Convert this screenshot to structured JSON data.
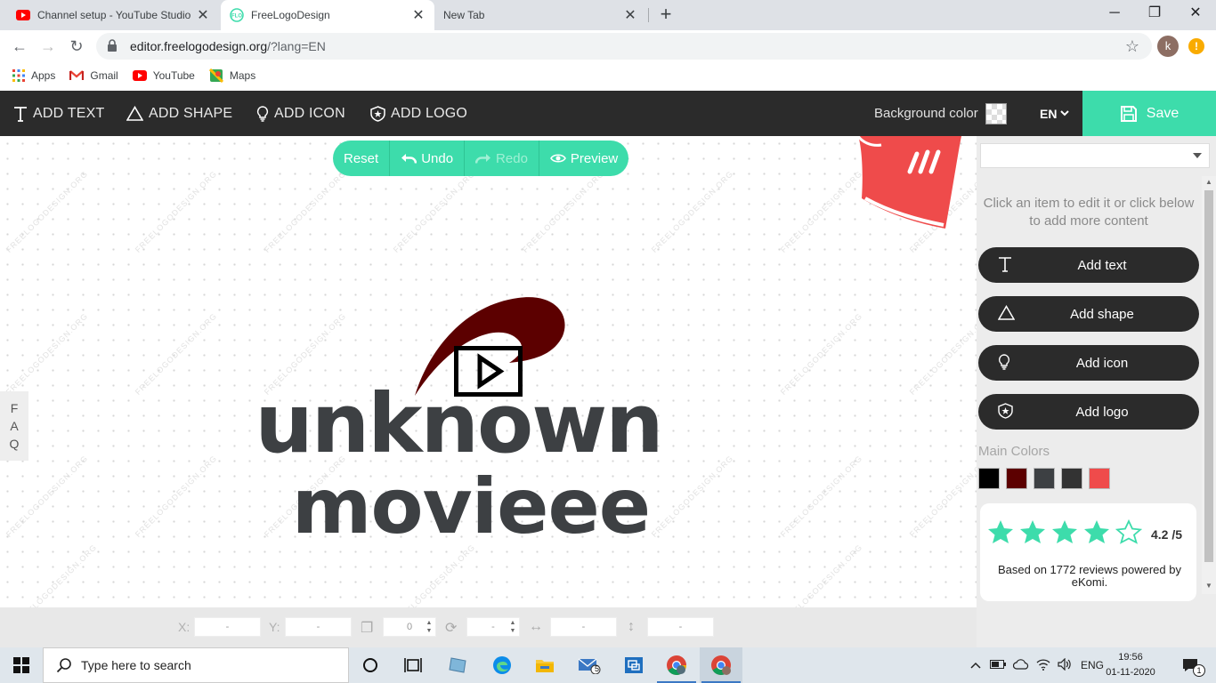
{
  "browser": {
    "tabs": [
      {
        "title": "Channel setup - YouTube Studio",
        "icon": "youtube-icon",
        "active": false
      },
      {
        "title": "FreeLogoDesign",
        "icon": "flo-icon",
        "active": true
      },
      {
        "title": "New Tab",
        "icon": "none",
        "active": false
      }
    ],
    "url_domain": "editor.freelogodesign.org",
    "url_path": "/?lang=EN",
    "profile_initial": "k",
    "update_badge": "!",
    "bookmarks": [
      {
        "label": "Apps",
        "icon": "apps-grid-icon"
      },
      {
        "label": "Gmail",
        "icon": "gmail-icon"
      },
      {
        "label": "YouTube",
        "icon": "youtube-icon"
      },
      {
        "label": "Maps",
        "icon": "maps-icon"
      }
    ]
  },
  "editor": {
    "tools": [
      {
        "label": "ADD TEXT",
        "icon": "text-icon"
      },
      {
        "label": "ADD SHAPE",
        "icon": "triangle-icon"
      },
      {
        "label": "ADD ICON",
        "icon": "lightbulb-icon"
      },
      {
        "label": "ADD LOGO",
        "icon": "shield-star-icon"
      }
    ],
    "background_color_label": "Background color",
    "language": "EN",
    "save_label": "Save",
    "actions": {
      "reset": "Reset",
      "undo": "Undo",
      "redo": "Redo",
      "preview": "Preview"
    },
    "faq_letters": [
      "F",
      "A",
      "Q"
    ],
    "watermark_text": "FREELOGODESIGN.ORG",
    "logo": {
      "line1": "unknown",
      "line2": "movieee",
      "colors": {
        "text": "#3d4043",
        "swoosh": "#5c0000",
        "icon": "#000000",
        "accent": "#ef4b4b"
      }
    },
    "coords": {
      "x_label": "X:",
      "x_value": "-",
      "y_label": "Y:",
      "y_value": "-",
      "layer_value": "0",
      "rotation_value": "-",
      "width_value": "-",
      "height_value": "-"
    }
  },
  "panel": {
    "hint": "Click an item to edit it or click below to add more content",
    "buttons": [
      {
        "label": "Add text",
        "icon": "text-icon"
      },
      {
        "label": "Add shape",
        "icon": "triangle-icon"
      },
      {
        "label": "Add icon",
        "icon": "lightbulb-icon"
      },
      {
        "label": "Add logo",
        "icon": "shield-star-icon"
      }
    ],
    "main_colors_label": "Main Colors",
    "main_colors": [
      "#000000",
      "#5c0000",
      "#3d4043",
      "#333333",
      "#ef4b4b"
    ],
    "rating": {
      "score": "4.2 /5",
      "stars": 4.2,
      "reviews": "Based on 1772 reviews powered by eKomi."
    }
  },
  "taskbar": {
    "search_placeholder": "Type here to search",
    "mail_badge": "5",
    "language": "ENG",
    "time": "19:56",
    "date": "01-11-2020",
    "notification_count": "1"
  }
}
